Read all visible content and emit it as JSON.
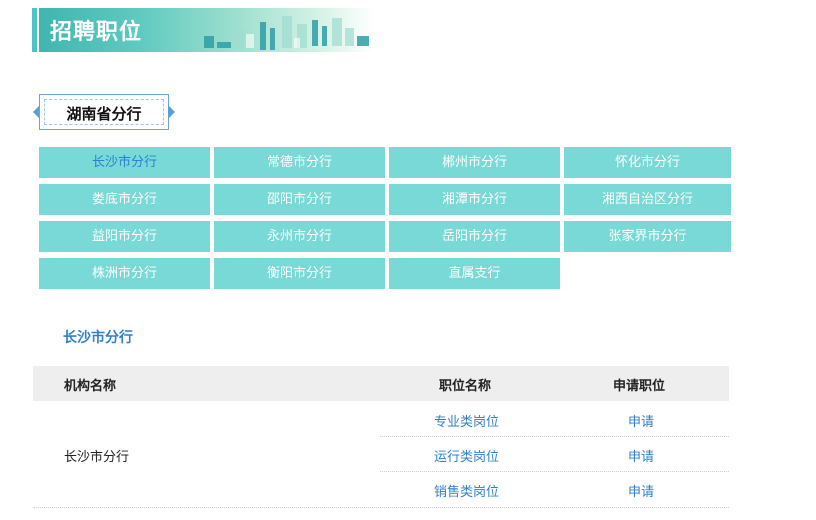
{
  "header": {
    "title": "招聘职位"
  },
  "province": {
    "label": "湖南省分行"
  },
  "branches": [
    "长沙市分行",
    "常德市分行",
    "郴州市分行",
    "怀化市分行",
    "娄底市分行",
    "邵阳市分行",
    "湘潭市分行",
    "湘西自治区分行",
    "益阳市分行",
    "永州市分行",
    "岳阳市分行",
    "张家界市分行",
    "株洲市分行",
    "衡阳市分行",
    "直属支行"
  ],
  "selected_branch": "长沙市分行",
  "section": {
    "title": "长沙市分行"
  },
  "table": {
    "headers": {
      "org": "机构名称",
      "position": "职位名称",
      "apply": "申请职位"
    },
    "org_name": "长沙市分行",
    "rows": [
      {
        "position": "专业类岗位",
        "apply": "申请"
      },
      {
        "position": "运行类岗位",
        "apply": "申请"
      },
      {
        "position": "销售类岗位",
        "apply": "申请"
      }
    ]
  },
  "colors": {
    "accent": "#2e7fcc",
    "tile": "#78d9d6",
    "header_bg": "#eeeeee"
  }
}
